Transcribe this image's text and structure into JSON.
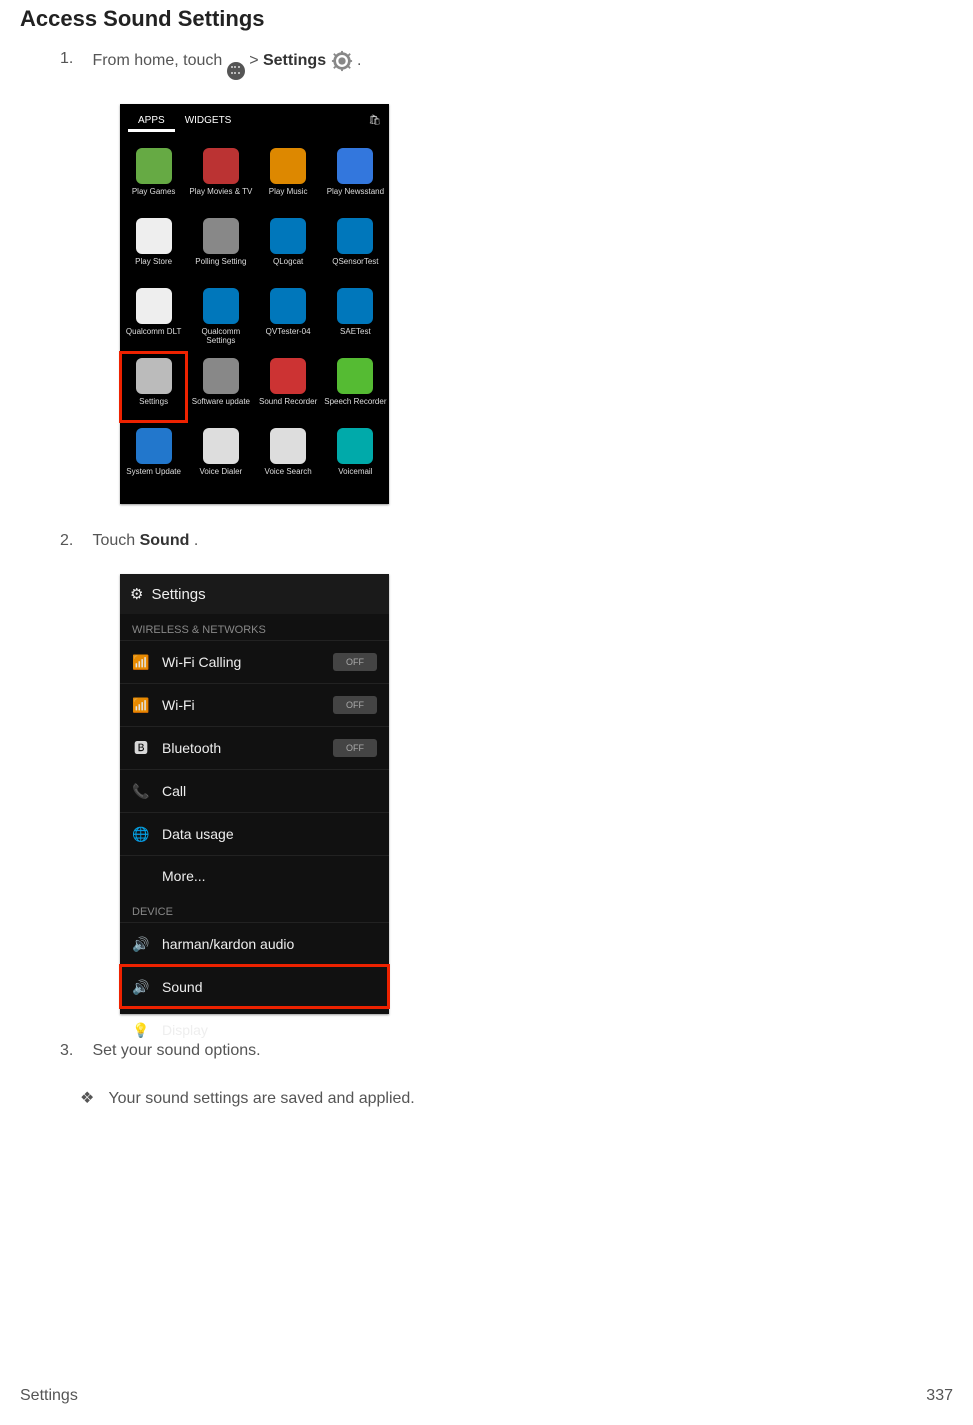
{
  "heading": "Access Sound Settings",
  "steps": [
    {
      "num": "1.",
      "pre": "From home, touch ",
      "mid1": " > ",
      "bold": "Settings",
      "post": " ",
      "end": "."
    },
    {
      "num": "2.",
      "pre": "Touch ",
      "bold": "Sound",
      "post": "."
    },
    {
      "num": "3.",
      "pre": "Set your sound options."
    }
  ],
  "result": "Your sound settings are saved and applied.",
  "shot1": {
    "tabs": {
      "apps": "APPS",
      "widgets": "WIDGETS"
    },
    "apps": [
      {
        "label": "Play Games",
        "color": "#6a4"
      },
      {
        "label": "Play Movies & TV",
        "color": "#b33"
      },
      {
        "label": "Play Music",
        "color": "#d80"
      },
      {
        "label": "Play Newsstand",
        "color": "#37d"
      },
      {
        "label": "Play Store",
        "color": "#eee"
      },
      {
        "label": "Polling Setting",
        "color": "#888"
      },
      {
        "label": "QLogcat",
        "color": "#07b"
      },
      {
        "label": "QSensorTest",
        "color": "#07b"
      },
      {
        "label": "Qualcomm DLT",
        "color": "#eee"
      },
      {
        "label": "Qualcomm Settings",
        "color": "#07b"
      },
      {
        "label": "QVTester-04",
        "color": "#07b"
      },
      {
        "label": "SAETest",
        "color": "#07b"
      },
      {
        "label": "Settings",
        "color": "#bbb",
        "hilite": true
      },
      {
        "label": "Software update",
        "color": "#888"
      },
      {
        "label": "Sound Recorder",
        "color": "#c33"
      },
      {
        "label": "Speech Recorder",
        "color": "#5b3"
      },
      {
        "label": "System Update",
        "color": "#27c"
      },
      {
        "label": "Voice Dialer",
        "color": "#ddd"
      },
      {
        "label": "Voice Search",
        "color": "#ddd"
      },
      {
        "label": "Voicemail",
        "color": "#0aa"
      }
    ]
  },
  "shot2": {
    "title": "Settings",
    "cat1": "WIRELESS & NETWORKS",
    "rows1": [
      {
        "icon": "📶",
        "label": "Wi-Fi Calling",
        "toggle": "OFF"
      },
      {
        "icon": "📶",
        "label": "Wi-Fi",
        "toggle": "OFF"
      },
      {
        "icon": "🅱",
        "label": "Bluetooth",
        "toggle": "OFF"
      },
      {
        "icon": "📞",
        "label": "Call"
      },
      {
        "icon": "🌐",
        "label": "Data usage"
      },
      {
        "label": "More...",
        "indent": true
      }
    ],
    "cat2": "DEVICE",
    "rows2": [
      {
        "icon": "🔊",
        "label": "harman/kardon audio"
      },
      {
        "icon": "🔊",
        "label": "Sound",
        "hilite": true
      },
      {
        "icon": "💡",
        "label": "Display"
      }
    ]
  },
  "footer": {
    "left": "Settings",
    "right": "337"
  }
}
